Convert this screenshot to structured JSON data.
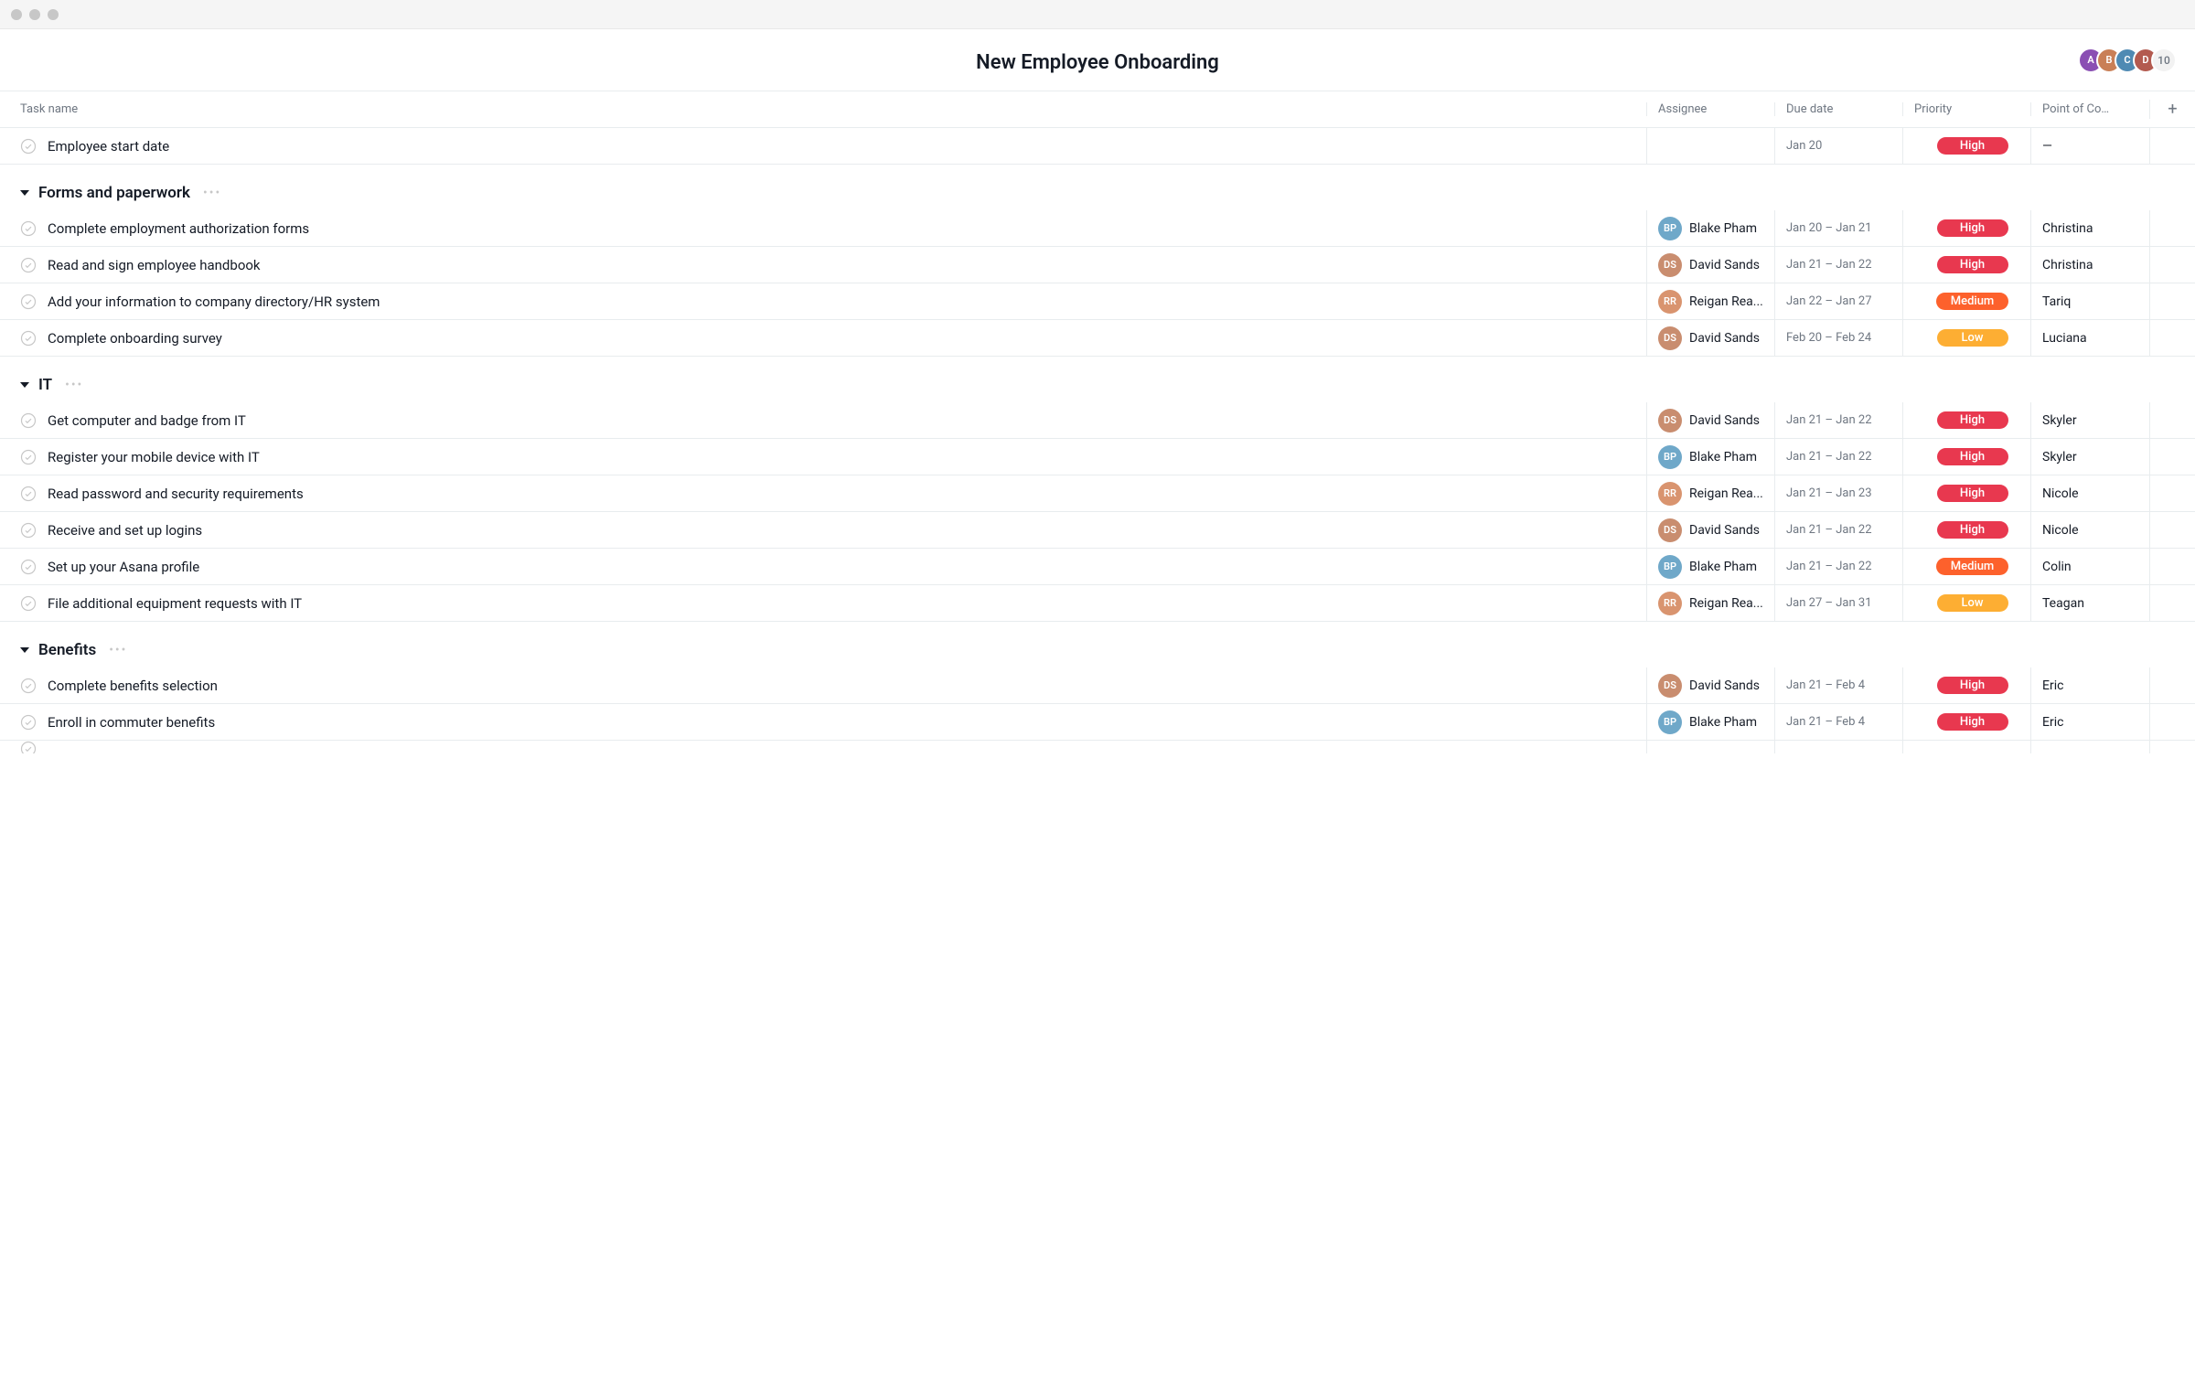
{
  "header": {
    "title": "New Employee Onboarding",
    "collaborators": [
      {
        "initials": "A",
        "bg": "#8a4fb3"
      },
      {
        "initials": "B",
        "bg": "#c97f56"
      },
      {
        "initials": "C",
        "bg": "#4f8ab3"
      },
      {
        "initials": "D",
        "bg": "#b35a4f"
      }
    ],
    "overflow_count": "10"
  },
  "columns": {
    "task": "Task name",
    "assignee": "Assignee",
    "due": "Due date",
    "priority": "Priority",
    "contact": "Point of Co…",
    "add": "+"
  },
  "assignee_colors": {
    "Blake Pham": "#6fa8c9",
    "David Sands": "#c98d6f",
    "Reigan Rea...": "#d9946f"
  },
  "top_task": {
    "name": "Employee start date",
    "assignee": "",
    "due": "Jan 20",
    "priority": "High",
    "priority_class": "prio-high",
    "contact": "—"
  },
  "sections": [
    {
      "title": "Forms and paperwork",
      "tasks": [
        {
          "name": "Complete employment authorization forms",
          "assignee": "Blake Pham",
          "due": "Jan 20 – Jan 21",
          "priority": "High",
          "priority_class": "prio-high",
          "contact": "Christina"
        },
        {
          "name": "Read and sign employee handbook",
          "assignee": "David Sands",
          "due": "Jan 21 – Jan 22",
          "priority": "High",
          "priority_class": "prio-high",
          "contact": "Christina"
        },
        {
          "name": "Add your information to company directory/HR system",
          "assignee": "Reigan Rea...",
          "due": "Jan 22 – Jan 27",
          "priority": "Medium",
          "priority_class": "prio-medium",
          "contact": "Tariq"
        },
        {
          "name": "Complete onboarding survey",
          "assignee": "David Sands",
          "due": "Feb 20 – Feb 24",
          "priority": "Low",
          "priority_class": "prio-low",
          "contact": "Luciana"
        }
      ]
    },
    {
      "title": "IT",
      "tasks": [
        {
          "name": "Get computer and badge from IT",
          "assignee": "David Sands",
          "due": "Jan 21 – Jan 22",
          "priority": "High",
          "priority_class": "prio-high",
          "contact": "Skyler"
        },
        {
          "name": "Register your mobile device with IT",
          "assignee": "Blake Pham",
          "due": "Jan 21 – Jan 22",
          "priority": "High",
          "priority_class": "prio-high",
          "contact": "Skyler"
        },
        {
          "name": "Read password and security requirements",
          "assignee": "Reigan Rea...",
          "due": "Jan 21 – Jan 23",
          "priority": "High",
          "priority_class": "prio-high",
          "contact": "Nicole"
        },
        {
          "name": "Receive and set up logins",
          "assignee": "David Sands",
          "due": "Jan 21 – Jan 22",
          "priority": "High",
          "priority_class": "prio-high",
          "contact": "Nicole"
        },
        {
          "name": "Set up your Asana profile",
          "assignee": "Blake Pham",
          "due": "Jan 21 – Jan 22",
          "priority": "Medium",
          "priority_class": "prio-medium",
          "contact": "Colin"
        },
        {
          "name": "File additional equipment requests with IT",
          "assignee": "Reigan Rea...",
          "due": "Jan 27 – Jan 31",
          "priority": "Low",
          "priority_class": "prio-low",
          "contact": "Teagan"
        }
      ]
    },
    {
      "title": "Benefits",
      "tasks": [
        {
          "name": "Complete benefits selection",
          "assignee": "David Sands",
          "due": "Jan 21 – Feb 4",
          "priority": "High",
          "priority_class": "prio-high",
          "contact": "Eric"
        },
        {
          "name": "Enroll in commuter benefits",
          "assignee": "Blake Pham",
          "due": "Jan 21 – Feb 4",
          "priority": "High",
          "priority_class": "prio-high",
          "contact": "Eric"
        }
      ]
    }
  ]
}
